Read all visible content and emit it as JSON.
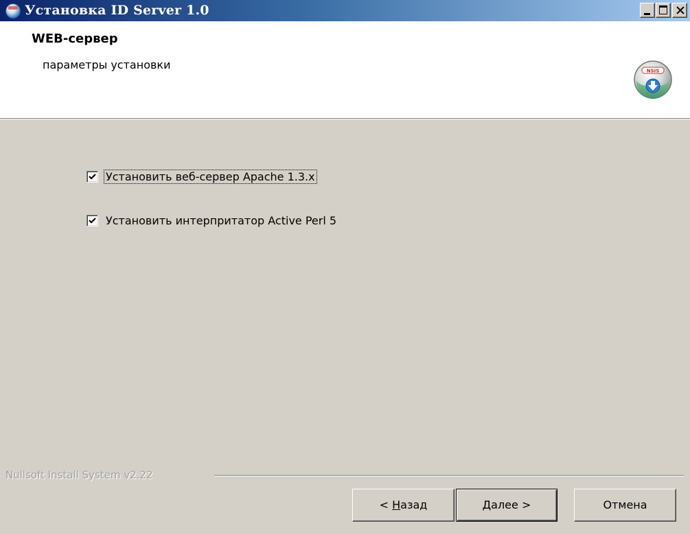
{
  "window": {
    "title": "Установка ID Server 1.0",
    "controls": {
      "minimize": "minimize",
      "maximize": "maximize",
      "close": "close"
    }
  },
  "header": {
    "title": "WEB-сервер",
    "subtitle": "параметры установки",
    "logo_icon": "nsis-installer-icon",
    "logo_text": "NSIS"
  },
  "options": [
    {
      "label": "Установить веб-сервер Apache 1.3.x",
      "checked": true,
      "focused": true
    },
    {
      "label": "Установить интерпритатор Active Perl 5",
      "checked": true,
      "focused": false
    }
  ],
  "branding": {
    "text": "Nullsoft Install System v2.22"
  },
  "buttons": {
    "back_prefix": "< ",
    "back_accel": "Н",
    "back_rest": "азад",
    "next_accel": "Д",
    "next_rest": "алее >",
    "cancel": "Отмена"
  },
  "colors": {
    "titlebar_start": "#0a246a",
    "titlebar_end": "#a6caf0",
    "dialog_bg": "#d4d0c8",
    "header_bg": "#ffffff",
    "branding_text": "#a0a0a0"
  }
}
